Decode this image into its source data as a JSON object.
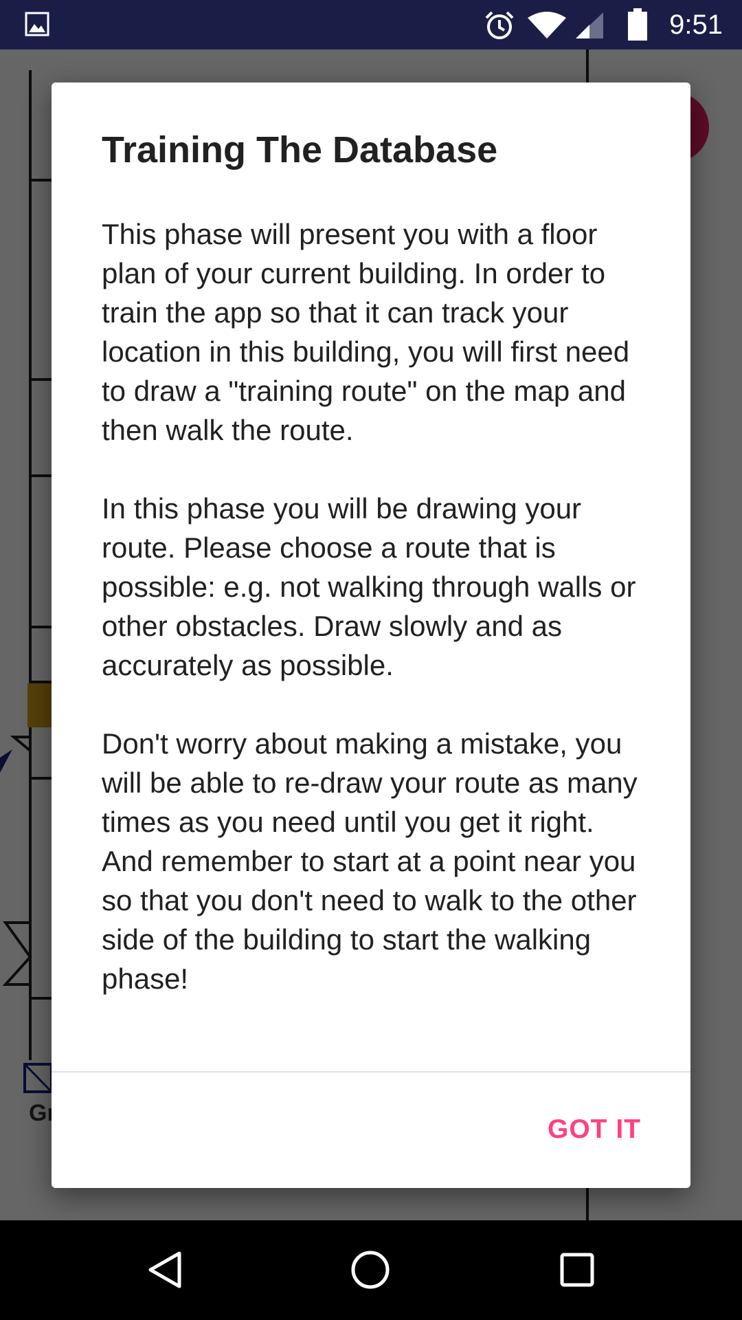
{
  "status_bar": {
    "time": "9:51",
    "icons": [
      "gallery-icon",
      "alarm-icon",
      "wifi-icon",
      "cell-signal-icon",
      "battery-icon"
    ],
    "background_color": "#1a1e47"
  },
  "background_app": {
    "label_fragment": "Gr",
    "fab_color": "#e91e63"
  },
  "dialog": {
    "title": "Training The Database",
    "paragraphs": [
      "This phase will present you with a floor plan of your current building. In order to train the app so that it can track your location in this building, you will first need to draw a \"training route\" on the map and then walk the route.",
      "In this phase you will be drawing your route. Please choose a route that is possible: e.g. not walking through walls or other obstacles. Draw slowly and as accurately as possible.",
      "Don't worry about making a mistake, you will be able to re-draw your route as many times as you need until you get it right. And remember to start at a point near you so that you don't need to walk to the other side of the building to start the walking phase!"
    ],
    "action_label": "GOT IT",
    "action_color": "#ff4081"
  },
  "nav_bar": {
    "icons": [
      "back-icon",
      "home-icon",
      "recents-icon"
    ]
  }
}
